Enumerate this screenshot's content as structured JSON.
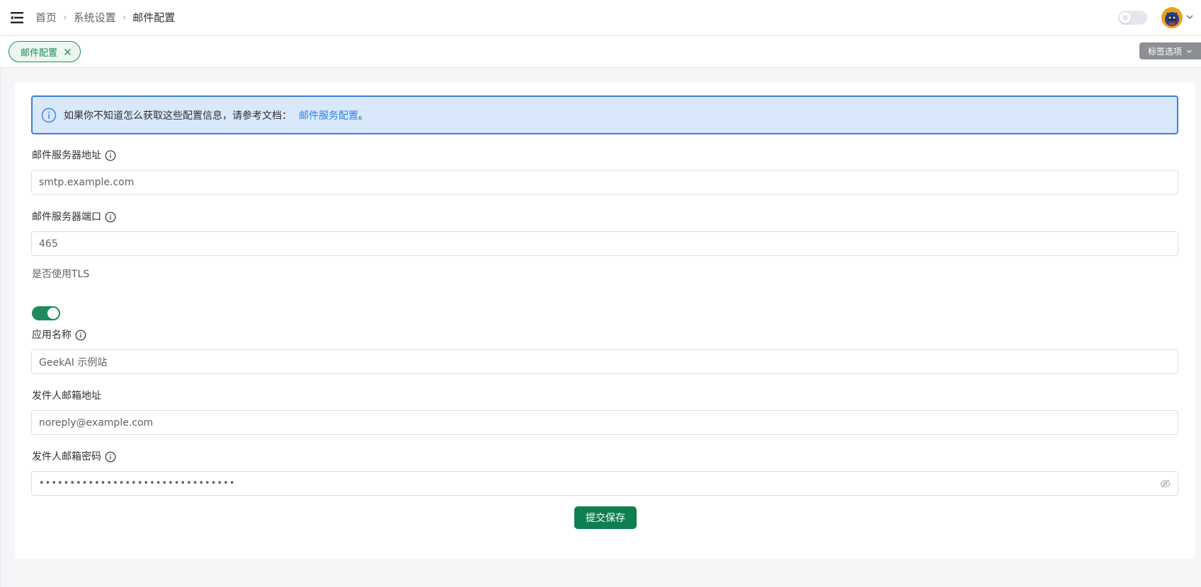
{
  "header": {
    "breadcrumb": [
      "首页",
      "系统设置",
      "邮件配置"
    ]
  },
  "tags": {
    "active_tag": "邮件配置",
    "options_label": "标签选项"
  },
  "alert": {
    "text": "如果你不知道怎么获取这些配置信息，请参考文档：",
    "link_text": "邮件服务配置",
    "suffix": "。"
  },
  "form": {
    "smtp_host": {
      "label": "邮件服务器地址",
      "value": "smtp.example.com"
    },
    "smtp_port": {
      "label": "邮件服务器端口",
      "value": "465"
    },
    "use_tls": {
      "label": "是否使用TLS",
      "enabled": true
    },
    "app_name": {
      "label": "应用名称",
      "value": "GeekAI 示例站"
    },
    "sender_email": {
      "label": "发件人邮箱地址",
      "value": "noreply@example.com"
    },
    "sender_password": {
      "label": "发件人邮箱密码",
      "masked_value": "••••••••••••••••••••••••••••••••"
    },
    "submit_label": "提交保存"
  },
  "colors": {
    "primary": "#0f7f4f",
    "tag_green": "#1f8a5b",
    "alert_border": "#3d7fe0",
    "alert_bg": "#d9e8fb",
    "link_blue": "#2f83e6"
  },
  "icons": [
    "menu-fold-icon",
    "chevron-right-icon",
    "sun-icon",
    "chevron-down-icon",
    "close-icon",
    "info-circle-icon",
    "eye-off-icon"
  ]
}
